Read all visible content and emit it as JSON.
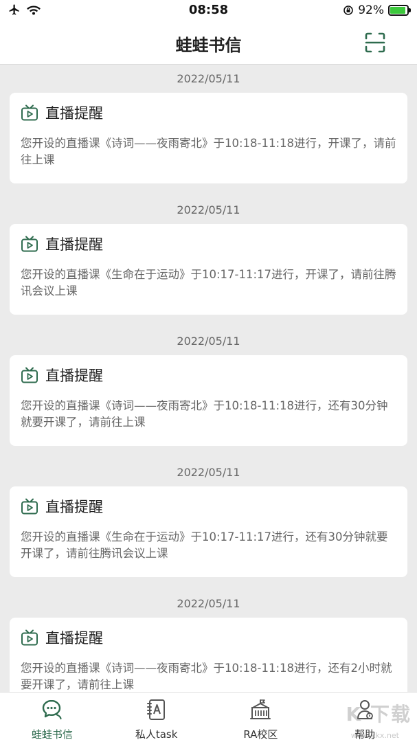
{
  "status_bar": {
    "time": "08:58",
    "battery_label": "92%",
    "battery_level": 0.92,
    "icons": [
      "airplane-icon",
      "wifi-icon",
      "orientation-lock-icon",
      "battery-charging-icon"
    ]
  },
  "nav": {
    "title": "蛙蛙书信",
    "scan_icon": "scan-icon"
  },
  "colors": {
    "accent": "#2e6b4e",
    "background": "#ebebeb",
    "card": "#ffffff",
    "body_text": "#666666"
  },
  "messages": [
    {
      "date": "2022/05/11",
      "icon": "live-tv-icon",
      "title": "直播提醒",
      "body": "您开设的直播课《诗词——夜雨寄北》于10:18-11:18进行，开课了，请前往上课"
    },
    {
      "date": "2022/05/11",
      "icon": "live-tv-icon",
      "title": "直播提醒",
      "body": "您开设的直播课《生命在于运动》于10:17-11:17进行，开课了，请前往腾讯会议上课"
    },
    {
      "date": "2022/05/11",
      "icon": "live-tv-icon",
      "title": "直播提醒",
      "body": "您开设的直播课《诗词——夜雨寄北》于10:18-11:18进行，还有30分钟就要开课了，请前往上课"
    },
    {
      "date": "2022/05/11",
      "icon": "live-tv-icon",
      "title": "直播提醒",
      "body": "您开设的直播课《生命在于运动》于10:17-11:17进行，还有30分钟就要开课了，请前往腾讯会议上课"
    },
    {
      "date": "2022/05/11",
      "icon": "live-tv-icon",
      "title": "直播提醒",
      "body": "您开设的直播课《诗词——夜雨寄北》于10:18-11:18进行，还有2小时就要开课了，请前往上课"
    }
  ],
  "tabs": [
    {
      "label": "蛙蛙书信",
      "icon": "chat-bubbles-icon",
      "active": true
    },
    {
      "label": "私人task",
      "icon": "notebook-icon",
      "active": false
    },
    {
      "label": "RA校区",
      "icon": "building-icon",
      "active": false
    },
    {
      "label": "帮助",
      "icon": "person-help-icon",
      "active": false
    }
  ],
  "watermark": {
    "text": "K 下载",
    "sub": "www.kkx.net"
  }
}
